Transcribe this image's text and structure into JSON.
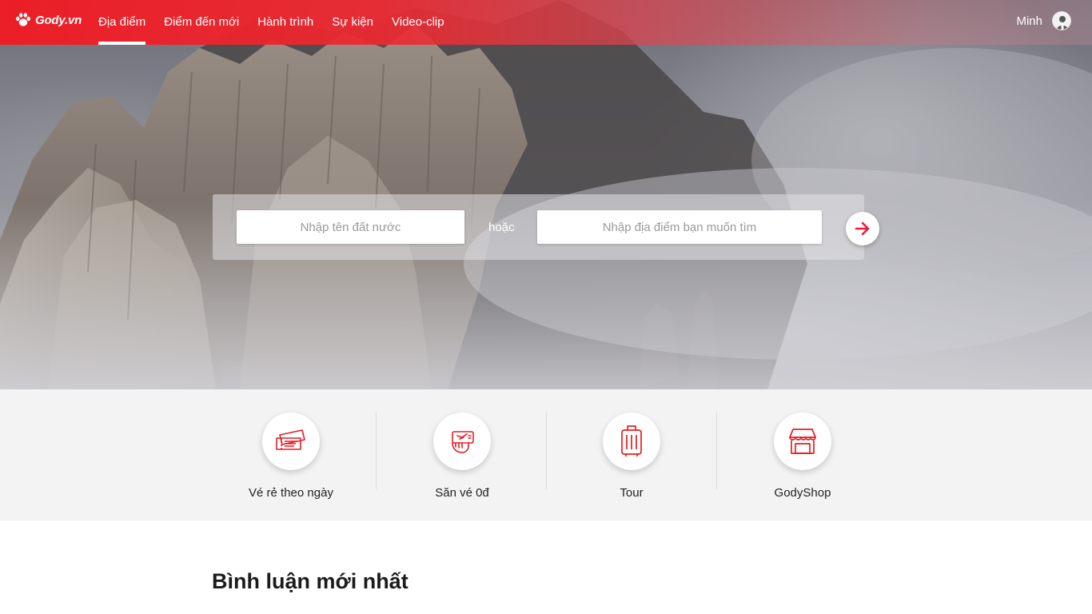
{
  "brand": {
    "name": "Gody.vn",
    "logo_icon": "paw-icon",
    "accent": "#ee1c25"
  },
  "nav": {
    "items": [
      {
        "label": "Địa điểm",
        "active": true
      },
      {
        "label": "Điểm đến mới",
        "active": false
      },
      {
        "label": "Hành trình",
        "active": false
      },
      {
        "label": "Sự kiện",
        "active": false
      },
      {
        "label": "Video-clip",
        "active": false
      }
    ]
  },
  "user": {
    "name": "Minh",
    "avatar_icon": "user-avatar-icon"
  },
  "search": {
    "country_placeholder": "Nhập tên đất nước",
    "or_label": "hoặc",
    "place_placeholder": "Nhập địa điểm bạn muốn tìm",
    "go_icon": "arrow-right-icon"
  },
  "services": [
    {
      "label": "Vé rẻ theo ngày",
      "icon": "ticket-icon"
    },
    {
      "label": "Săn vé 0đ",
      "icon": "hand-ticket-icon"
    },
    {
      "label": "Tour",
      "icon": "luggage-icon"
    },
    {
      "label": "GodyShop",
      "icon": "shop-icon"
    }
  ],
  "section": {
    "title": "Bình luận mới nhất"
  }
}
